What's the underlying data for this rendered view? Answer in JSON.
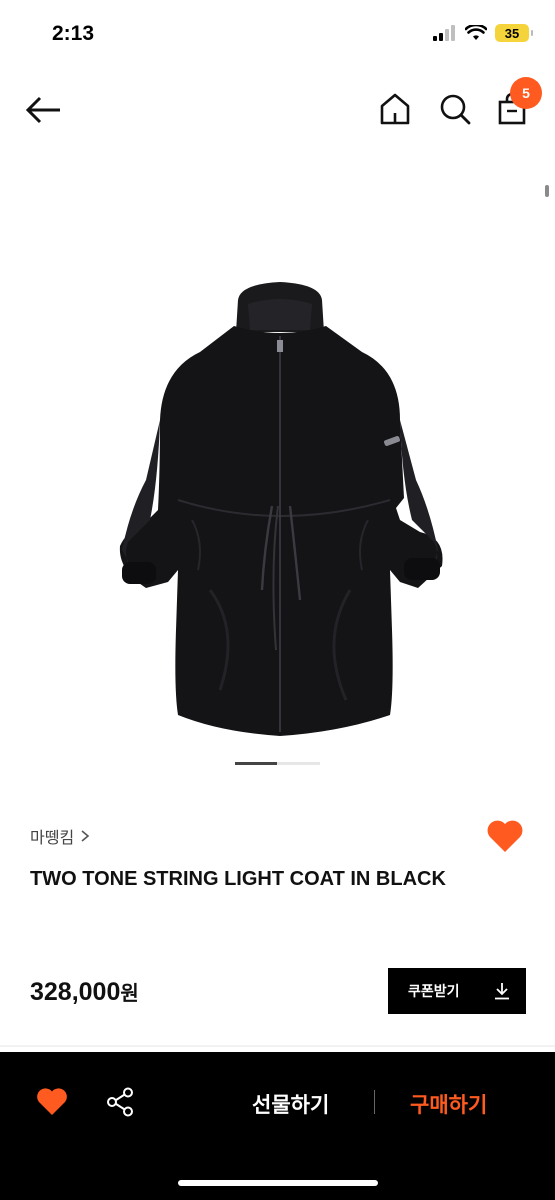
{
  "status_bar": {
    "time": "2:13",
    "battery": "35"
  },
  "nav": {
    "back_icon": "back-arrow-icon",
    "home_icon": "home-icon",
    "search_icon": "search-icon",
    "bag_icon": "shopping-bag-icon",
    "cart_count": "5"
  },
  "product": {
    "brand": "마뗑킴",
    "title": "TWO TONE STRING LIGHT COAT IN BLACK",
    "price": "328,000",
    "currency": "원",
    "coupon_label": "쿠폰받기",
    "image_page": 1,
    "image_total": 2
  },
  "bottom_bar": {
    "gift_label": "선물하기",
    "buy_label": "구매하기"
  },
  "colors": {
    "accent": "#ff5a1f",
    "dark": "#000000"
  }
}
